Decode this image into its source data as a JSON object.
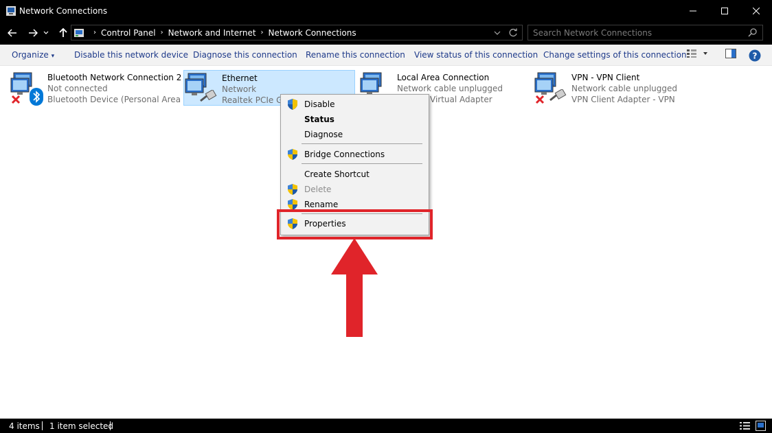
{
  "window": {
    "title": "Network Connections"
  },
  "address": {
    "crumbs": [
      "Control Panel",
      "Network and Internet",
      "Network Connections"
    ]
  },
  "search": {
    "placeholder": "Search Network Connections"
  },
  "commands": {
    "organize": "Organize",
    "disable": "Disable this network device",
    "diagnose": "Diagnose this connection",
    "rename": "Rename this connection",
    "view_status": "View status of this connection",
    "change_settings": "Change settings of this connection"
  },
  "connections": [
    {
      "name": "Bluetooth Network Connection 2",
      "status": "Not connected",
      "device": "Bluetooth Device (Personal Area ..."
    },
    {
      "name": "Ethernet",
      "status": "Network",
      "device": "Realtek PCIe Gb"
    },
    {
      "name": "Local Area Connection",
      "status": "Network cable unplugged",
      "device": "Virtual Adapter"
    },
    {
      "name": "VPN - VPN Client",
      "status": "Network cable unplugged",
      "device": "VPN Client Adapter - VPN"
    }
  ],
  "context_menu": {
    "disable": "Disable",
    "status": "Status",
    "diagnose": "Diagnose",
    "bridge": "Bridge Connections",
    "shortcut": "Create Shortcut",
    "delete": "Delete",
    "rename": "Rename",
    "properties": "Properties"
  },
  "status": {
    "items": "4 items",
    "selected": "1 item selected"
  },
  "colors": {
    "accent": "#0078d7",
    "highlight": "#e0242a",
    "selection": "#cce8ff"
  }
}
